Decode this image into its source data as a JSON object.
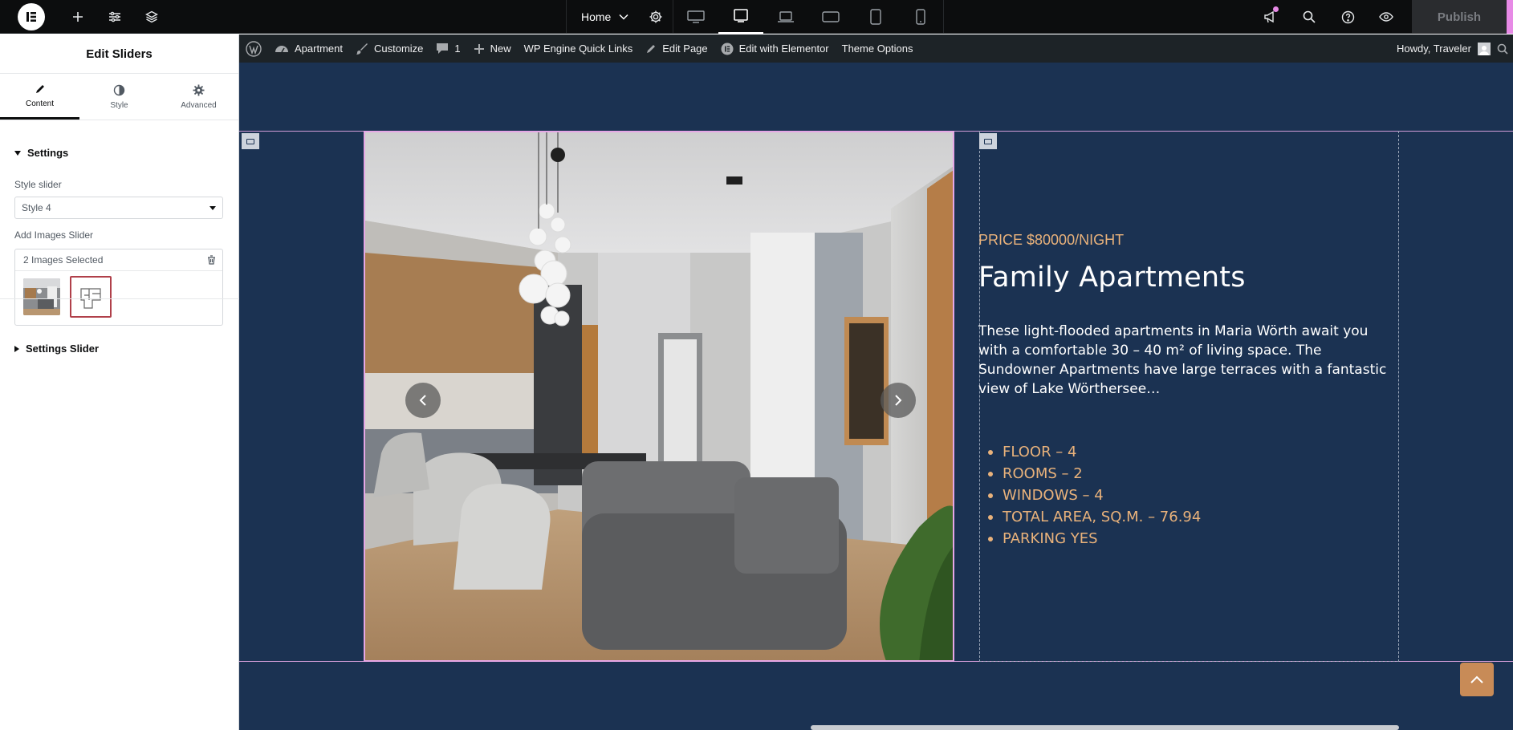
{
  "topbar": {
    "page_name": "Home",
    "publish_label": "Publish",
    "devices": [
      "desktop",
      "tablet",
      "laptop",
      "tablet-landscape",
      "mobile",
      "mobile-small"
    ],
    "active_device": "tablet"
  },
  "panel": {
    "title": "Edit Sliders",
    "tabs": [
      {
        "label": "Content",
        "icon": "pencil-icon"
      },
      {
        "label": "Style",
        "icon": "half-circle-icon"
      },
      {
        "label": "Advanced",
        "icon": "gear-icon"
      }
    ],
    "settings_section": "Settings",
    "style_slider_label": "Style slider",
    "style_slider_value": "Style 4",
    "add_images_label": "Add Images Slider",
    "images_selected": "2 Images Selected",
    "settings_slider_section": "Settings Slider"
  },
  "adminbar": {
    "items": [
      "Apartment",
      "Customize",
      "1",
      "New",
      "WP Engine Quick Links",
      "Edit Page",
      "Edit with Elementor",
      "Theme Options"
    ],
    "greeting": "Howdy, Traveler"
  },
  "content": {
    "price": "PRICE $80000/NIGHT",
    "title": "Family Apartments",
    "description": "These light-flooded apartments in Maria Wörth await you with a comfortable 30 – 40 m² of living space. The Sundowner Apartments have large terraces with a fantastic view of Lake Wörthersee…",
    "features": [
      "FLOOR – 4",
      "ROOMS – 2",
      "WINDOWS – 4",
      "TOTAL AREA, SQ.M. – 76.94",
      "PARKING YES"
    ]
  },
  "colors": {
    "canvas_bg": "#1b3252",
    "accent": "#e9b27b",
    "selection": "#e6a7e6"
  }
}
